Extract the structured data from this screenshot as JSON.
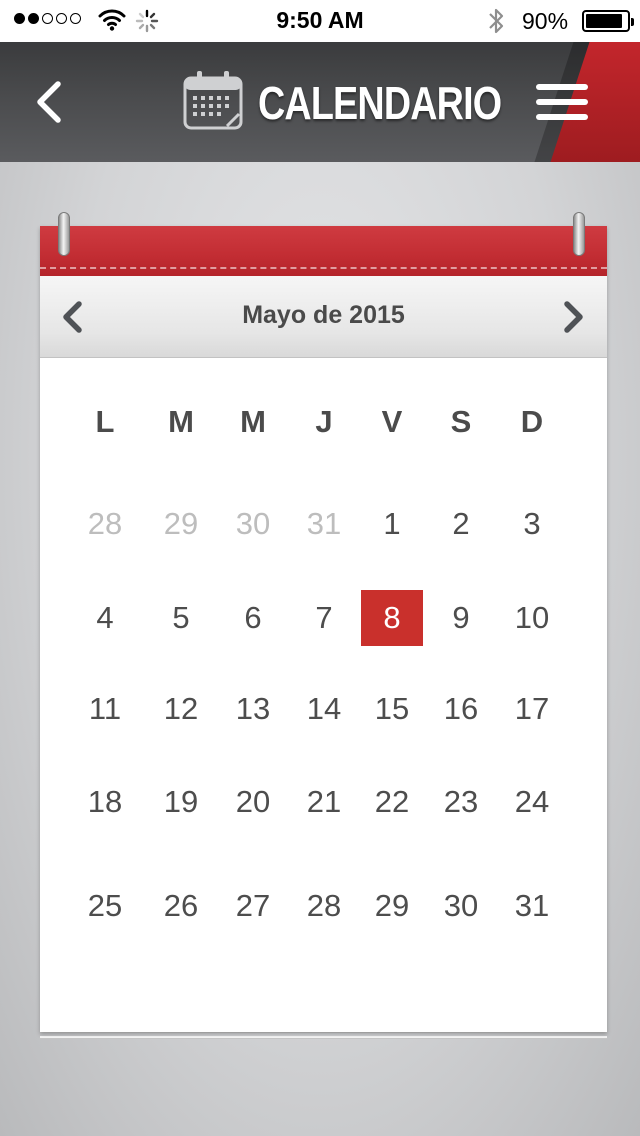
{
  "status_bar": {
    "time": "9:50 AM",
    "battery_percent_text": "90%",
    "battery_level": 0.9,
    "signal_bars_filled": 2,
    "signal_bars_total": 5,
    "icons": [
      "signal-dots-icon",
      "wifi-icon",
      "activity-spinner-icon",
      "bluetooth-icon",
      "battery-icon"
    ]
  },
  "nav": {
    "title": "CALENDARIO",
    "icons": [
      "back-chevron-icon",
      "calendar-icon",
      "hamburger-menu-icon"
    ],
    "accent_color": "#c3262c"
  },
  "calendar": {
    "month_label": "Mayo de 2015",
    "weekdays": [
      "L",
      "M",
      "M",
      "J",
      "V",
      "S",
      "D"
    ],
    "selected_day": "8",
    "selected_color": "#c9302c",
    "weeks": [
      [
        {
          "d": "28",
          "muted": true
        },
        {
          "d": "29",
          "muted": true
        },
        {
          "d": "30",
          "muted": true
        },
        {
          "d": "31",
          "muted": true
        },
        {
          "d": "1"
        },
        {
          "d": "2"
        },
        {
          "d": "3"
        }
      ],
      [
        {
          "d": "4"
        },
        {
          "d": "5"
        },
        {
          "d": "6"
        },
        {
          "d": "7"
        },
        {
          "d": "8",
          "selected": true
        },
        {
          "d": "9"
        },
        {
          "d": "10"
        }
      ],
      [
        {
          "d": "11"
        },
        {
          "d": "12"
        },
        {
          "d": "13"
        },
        {
          "d": "14"
        },
        {
          "d": "15"
        },
        {
          "d": "16"
        },
        {
          "d": "17"
        }
      ],
      [
        {
          "d": "18"
        },
        {
          "d": "19"
        },
        {
          "d": "20"
        },
        {
          "d": "21"
        },
        {
          "d": "22"
        },
        {
          "d": "23"
        },
        {
          "d": "24"
        }
      ],
      [
        {
          "d": "25"
        },
        {
          "d": "26"
        },
        {
          "d": "27"
        },
        {
          "d": "28"
        },
        {
          "d": "29"
        },
        {
          "d": "30"
        },
        {
          "d": "31"
        }
      ]
    ]
  }
}
